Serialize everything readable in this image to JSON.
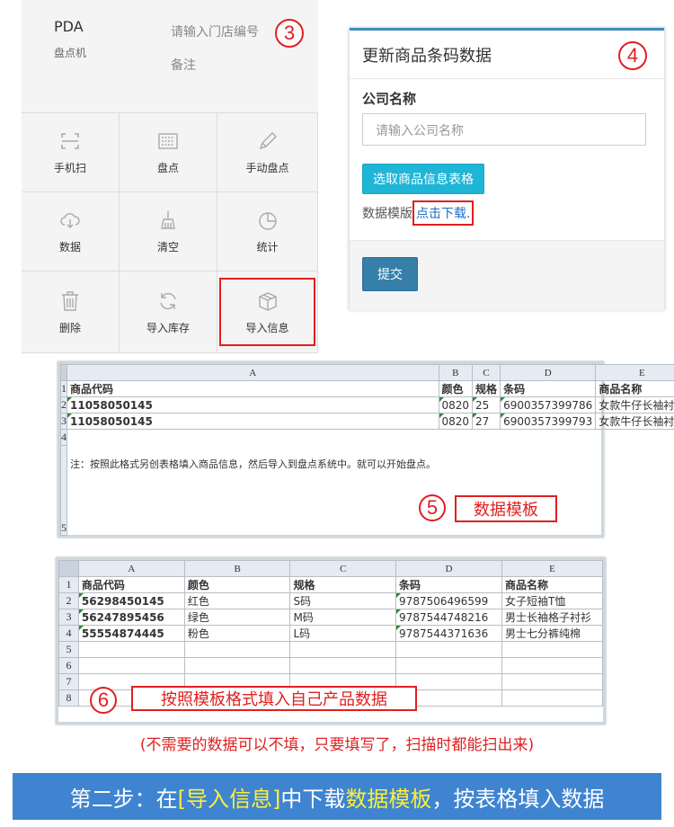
{
  "pda": {
    "title": "PDA",
    "subtitle": "盘点机",
    "store_placeholder": "请输入门店编号",
    "remark_placeholder": "备注",
    "step_number": "3",
    "grid": [
      {
        "label": "手机扫",
        "icon": "scan-icon"
      },
      {
        "label": "盘点",
        "icon": "barcode-icon"
      },
      {
        "label": "手动盘点",
        "icon": "pencil-icon"
      },
      {
        "label": "数据",
        "icon": "cloud-download-icon"
      },
      {
        "label": "清空",
        "icon": "broom-icon"
      },
      {
        "label": "统计",
        "icon": "pie-chart-icon"
      },
      {
        "label": "删除",
        "icon": "trash-icon"
      },
      {
        "label": "导入库存",
        "icon": "refresh-icon"
      },
      {
        "label": "导入信息",
        "icon": "box-icon"
      }
    ]
  },
  "form": {
    "title": "更新商品条码数据",
    "step_number": "4",
    "company_label": "公司名称",
    "company_placeholder": "请输入公司名称",
    "select_button": "选取商品信息表格",
    "template_text": "数据模版",
    "download_link": "点击下载",
    "period": ".",
    "submit_button": "提交"
  },
  "sheet1": {
    "col_headers": [
      "A",
      "B",
      "C",
      "D",
      "E"
    ],
    "row_numbers": [
      "1",
      "2",
      "3",
      "4",
      "5"
    ],
    "rows": [
      [
        "商品代码",
        "颜色",
        "规格",
        "条码",
        "商品名称"
      ],
      [
        "11058050145",
        "0820",
        "25",
        "6900357399786",
        "女款牛仔长袖衬衫"
      ],
      [
        "11058050145",
        "0820",
        "27",
        "6900357399793",
        "女款牛仔长袖衬衫"
      ]
    ],
    "note": "注：按照此格式另创表格填入商品信息，然后导入到盘点系统中。就可以开始盘点。",
    "step_number": "5",
    "tag": "数据模板"
  },
  "sheet2": {
    "col_headers": [
      "A",
      "B",
      "C",
      "D",
      "E"
    ],
    "row_numbers": [
      "1",
      "2",
      "3",
      "4",
      "5",
      "6",
      "7",
      "8"
    ],
    "rows": [
      [
        "商品代码",
        "颜色",
        "规格",
        "条码",
        "商品名称"
      ],
      [
        "56298450145",
        "红色",
        "S码",
        "9787506496599",
        "女子短袖T恤"
      ],
      [
        "56247895456",
        "绿色",
        "M码",
        "9787544748216",
        "男士长袖格子衬衫"
      ],
      [
        "55554874445",
        "粉色",
        "L码",
        "9787544371636",
        "男士七分裤纯棉"
      ]
    ],
    "step_number": "6",
    "tag": "按照模板格式填入自己产品数据"
  },
  "caption": "(不需要的数据可以不填，只要填写了，扫描时都能扫出来)",
  "banner": {
    "part1": "第二步：在",
    "part2": "[导入信息]",
    "part3": "中下载",
    "part4": "数据模板",
    "part5": "，按表格填入数据"
  },
  "colors": {
    "accent": "#3e84d0",
    "highlight": "#ffef3a",
    "red": "#e02020",
    "button": "#1fb5d6",
    "submit": "#367fa9"
  }
}
